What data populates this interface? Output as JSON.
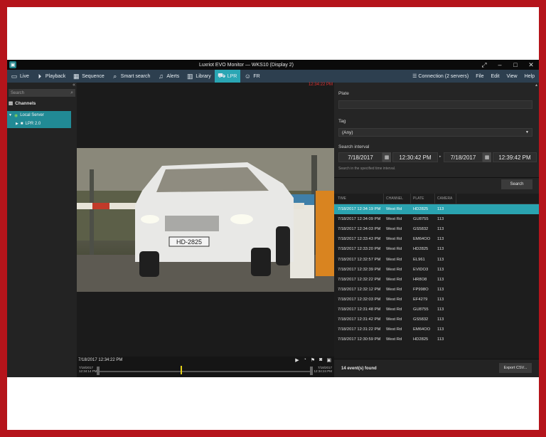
{
  "window": {
    "title": "Luxriot EVO Monitor — WKS10 (Display 2)"
  },
  "nav": [
    {
      "label": "Live",
      "icon": "monitor-icon"
    },
    {
      "label": "Playback",
      "icon": "playback-icon"
    },
    {
      "label": "Sequence",
      "icon": "grid-icon"
    },
    {
      "label": "Smart search",
      "icon": "smart-search-icon"
    },
    {
      "label": "Alerts",
      "icon": "bell-icon"
    },
    {
      "label": "Library",
      "icon": "library-icon"
    },
    {
      "label": "LPR",
      "icon": "car-icon"
    },
    {
      "label": "FR",
      "icon": "face-icon"
    }
  ],
  "menu_right": {
    "connection": "Connection (2 servers)",
    "file": "File",
    "edit": "Edit",
    "view": "View",
    "help": "Help"
  },
  "sidebar": {
    "search_placeholder": "Search",
    "channels_heading": "Channels",
    "tree": [
      {
        "label": "Local Server"
      },
      {
        "label": "LPR 2.0"
      }
    ]
  },
  "video": {
    "timestamp": "12:34:22 PM",
    "plate_text": "HD-2825"
  },
  "timeline": {
    "current": "7/18/2017 12:34:22 PM",
    "start_date": "7/18/2017",
    "start_time": "12:34:14 PM",
    "end_date": "7/18/2017",
    "end_time": "12:34:24 PM"
  },
  "filters": {
    "plate_label": "Plate",
    "plate_value": "",
    "tag_label": "Tag",
    "tag_value": "(Any)",
    "interval_label": "Search interval",
    "start_date": "7/18/2017",
    "start_time": "12:30:42 PM",
    "end_date": "7/18/2017",
    "end_time": "12:39:42 PM",
    "hint": "Search in the specified time interval.",
    "search_button": "Search"
  },
  "results": {
    "columns": [
      "TIME",
      "CHANNEL",
      "PLATE",
      "CAMERA"
    ],
    "rows": [
      [
        "7/18/2017 12:34:19 PM",
        "West Rd",
        "HD2825",
        "113"
      ],
      [
        "7/18/2017 12:34:09 PM",
        "West Rd",
        "GU8755",
        "113"
      ],
      [
        "7/18/2017 12:34:03 PM",
        "West Rd",
        "GS5832",
        "113"
      ],
      [
        "7/18/2017 12:33:43 PM",
        "West Rd",
        "EM64OO",
        "113"
      ],
      [
        "7/18/2017 12:33:20 PM",
        "West Rd",
        "HD2825",
        "113"
      ],
      [
        "7/18/2017 12:32:57 PM",
        "West Rd",
        "EL961",
        "113"
      ],
      [
        "7/18/2017 12:32:39 PM",
        "West Rd",
        "EVIDO3",
        "113"
      ],
      [
        "7/18/2017 12:32:22 PM",
        "West Rd",
        "HR8O8",
        "113"
      ],
      [
        "7/18/2017 12:32:12 PM",
        "West Rd",
        "FP998O",
        "113"
      ],
      [
        "7/18/2017 12:32:03 PM",
        "West Rd",
        "EF4279",
        "113"
      ],
      [
        "7/18/2017 12:31:48 PM",
        "West Rd",
        "GU8755",
        "113"
      ],
      [
        "7/18/2017 12:31:42 PM",
        "West Rd",
        "GS5832",
        "113"
      ],
      [
        "7/18/2017 12:31:22 PM",
        "West Rd",
        "EM64OO",
        "113"
      ],
      [
        "7/18/2017 12:30:59 PM",
        "West Rd",
        "HD2825",
        "113"
      ]
    ],
    "selected_index": 0,
    "found_text": "14 event(s) found",
    "export_button": "Export CSV..."
  },
  "colors": {
    "accent": "#2aa6b4",
    "menubar": "#2d3f4f",
    "border": "#b5141b"
  }
}
